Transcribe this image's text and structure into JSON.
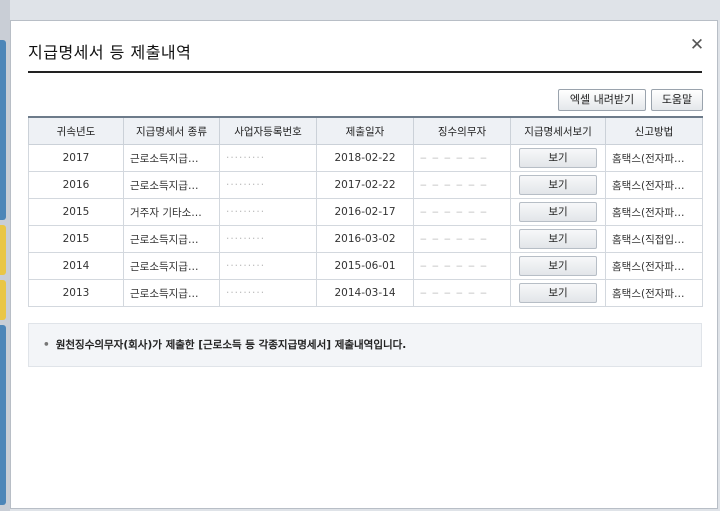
{
  "dialog": {
    "title": "지급명세서 등 제출내역",
    "close_glyph": "✕"
  },
  "toolbar": {
    "excel_label": "엑셀 내려받기",
    "help_label": "도움말"
  },
  "table": {
    "headers": [
      "귀속년도",
      "지급명세서 종류",
      "사업자등록번호",
      "제출일자",
      "징수의무자",
      "지급명세서보기",
      "신고방법"
    ],
    "rows": [
      {
        "year": "2017",
        "type": "근로소득지급…",
        "bizno": "·········",
        "date": "2018-02-22",
        "payer": "‒ ‒ ‒ ‒ ‒ ‒",
        "view": "보기",
        "method": "홈택스(전자파…"
      },
      {
        "year": "2016",
        "type": "근로소득지급…",
        "bizno": "·········",
        "date": "2017-02-22",
        "payer": "‒ ‒ ‒ ‒ ‒ ‒",
        "view": "보기",
        "method": "홈택스(전자파…"
      },
      {
        "year": "2015",
        "type": "거주자 기타소…",
        "bizno": "·········",
        "date": "2016-02-17",
        "payer": "‒ ‒ ‒ ‒ ‒ ‒",
        "view": "보기",
        "method": "홈택스(전자파…"
      },
      {
        "year": "2015",
        "type": "근로소득지급…",
        "bizno": "·········",
        "date": "2016-03-02",
        "payer": "‒ ‒ ‒ ‒ ‒ ‒",
        "view": "보기",
        "method": "홈택스(직접입…"
      },
      {
        "year": "2014",
        "type": "근로소득지급…",
        "bizno": "·········",
        "date": "2015-06-01",
        "payer": "‒ ‒ ‒ ‒ ‒ ‒",
        "view": "보기",
        "method": "홈택스(전자파…"
      },
      {
        "year": "2013",
        "type": "근로소득지급…",
        "bizno": "·········",
        "date": "2014-03-14",
        "payer": "‒ ‒ ‒ ‒ ‒ ‒",
        "view": "보기",
        "method": "홈택스(전자파…"
      }
    ]
  },
  "notice": {
    "bullet": "•",
    "text": "원천징수의무자(회사)가 제출한 [근로소득 등 각종지급명세서] 제출내역입니다."
  }
}
